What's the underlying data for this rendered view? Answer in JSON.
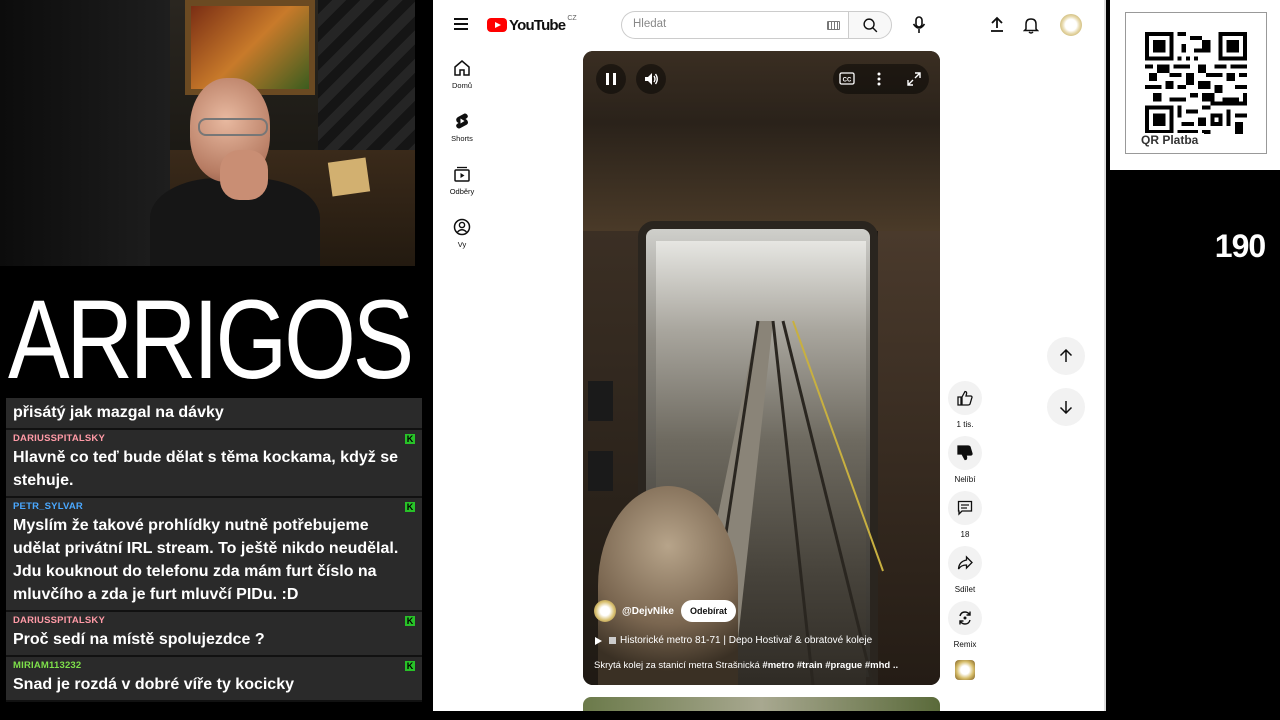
{
  "stream": {
    "logo_text": "ARRIGOS",
    "viewer_count": "190",
    "qr_label": "QR Platba"
  },
  "chat": [
    {
      "user": "",
      "text": "přisátý jak mazgal na dávky",
      "color": "#ffffff",
      "badge": false
    },
    {
      "user": "DARIUSSPITALSKY",
      "text": "Hlavně co teď bude dělat s těma kockama, když se stehuje.",
      "color": "#ff9aa6",
      "badge": true
    },
    {
      "user": "PETR_SYLVAR",
      "text": "Myslím že takové prohlídky nutně potřebujeme udělat privátní IRL stream. To ještě nikdo neudělal. Jdu kouknout do telefonu zda mám furt číslo na mluvčího a zda je furt mluvčí PIDu. :D",
      "color": "#4aa8ff",
      "badge": true
    },
    {
      "user": "DARIUSSPITALSKY",
      "text": "Proč sedí na místě spolujezdce ?",
      "color": "#ff9aa6",
      "badge": true
    },
    {
      "user": "MIRIAM113232",
      "text": "Snad je rozdá v dobré víře ty kocicky",
      "color": "#7ee04a",
      "badge": true
    }
  ],
  "youtube": {
    "logo_text": "YouTube",
    "region": "CZ",
    "search_placeholder": "Hledat",
    "nav": [
      {
        "label": "Domů",
        "icon": "home-icon"
      },
      {
        "label": "Shorts",
        "icon": "shorts-icon"
      },
      {
        "label": "Odběry",
        "icon": "subscriptions-icon"
      },
      {
        "label": "Vy",
        "icon": "you-icon"
      }
    ],
    "video": {
      "channel": "@DejvNike",
      "subscribe_label": "Odebírat",
      "title": "Historické metro 81-71 | Depo Hostivař & obratové koleje",
      "description_plain": "Skrytá kolej za stanicí metra Strašnická ",
      "description_tags": "#metro #train #prague #mhd ..",
      "state": "playing"
    },
    "actions": {
      "likes": "1 tis.",
      "dislike": "Nelíbí",
      "comments": "18",
      "share": "Sdílet",
      "remix": "Remix"
    },
    "colors": {
      "brand_red": "#ff0000"
    }
  }
}
